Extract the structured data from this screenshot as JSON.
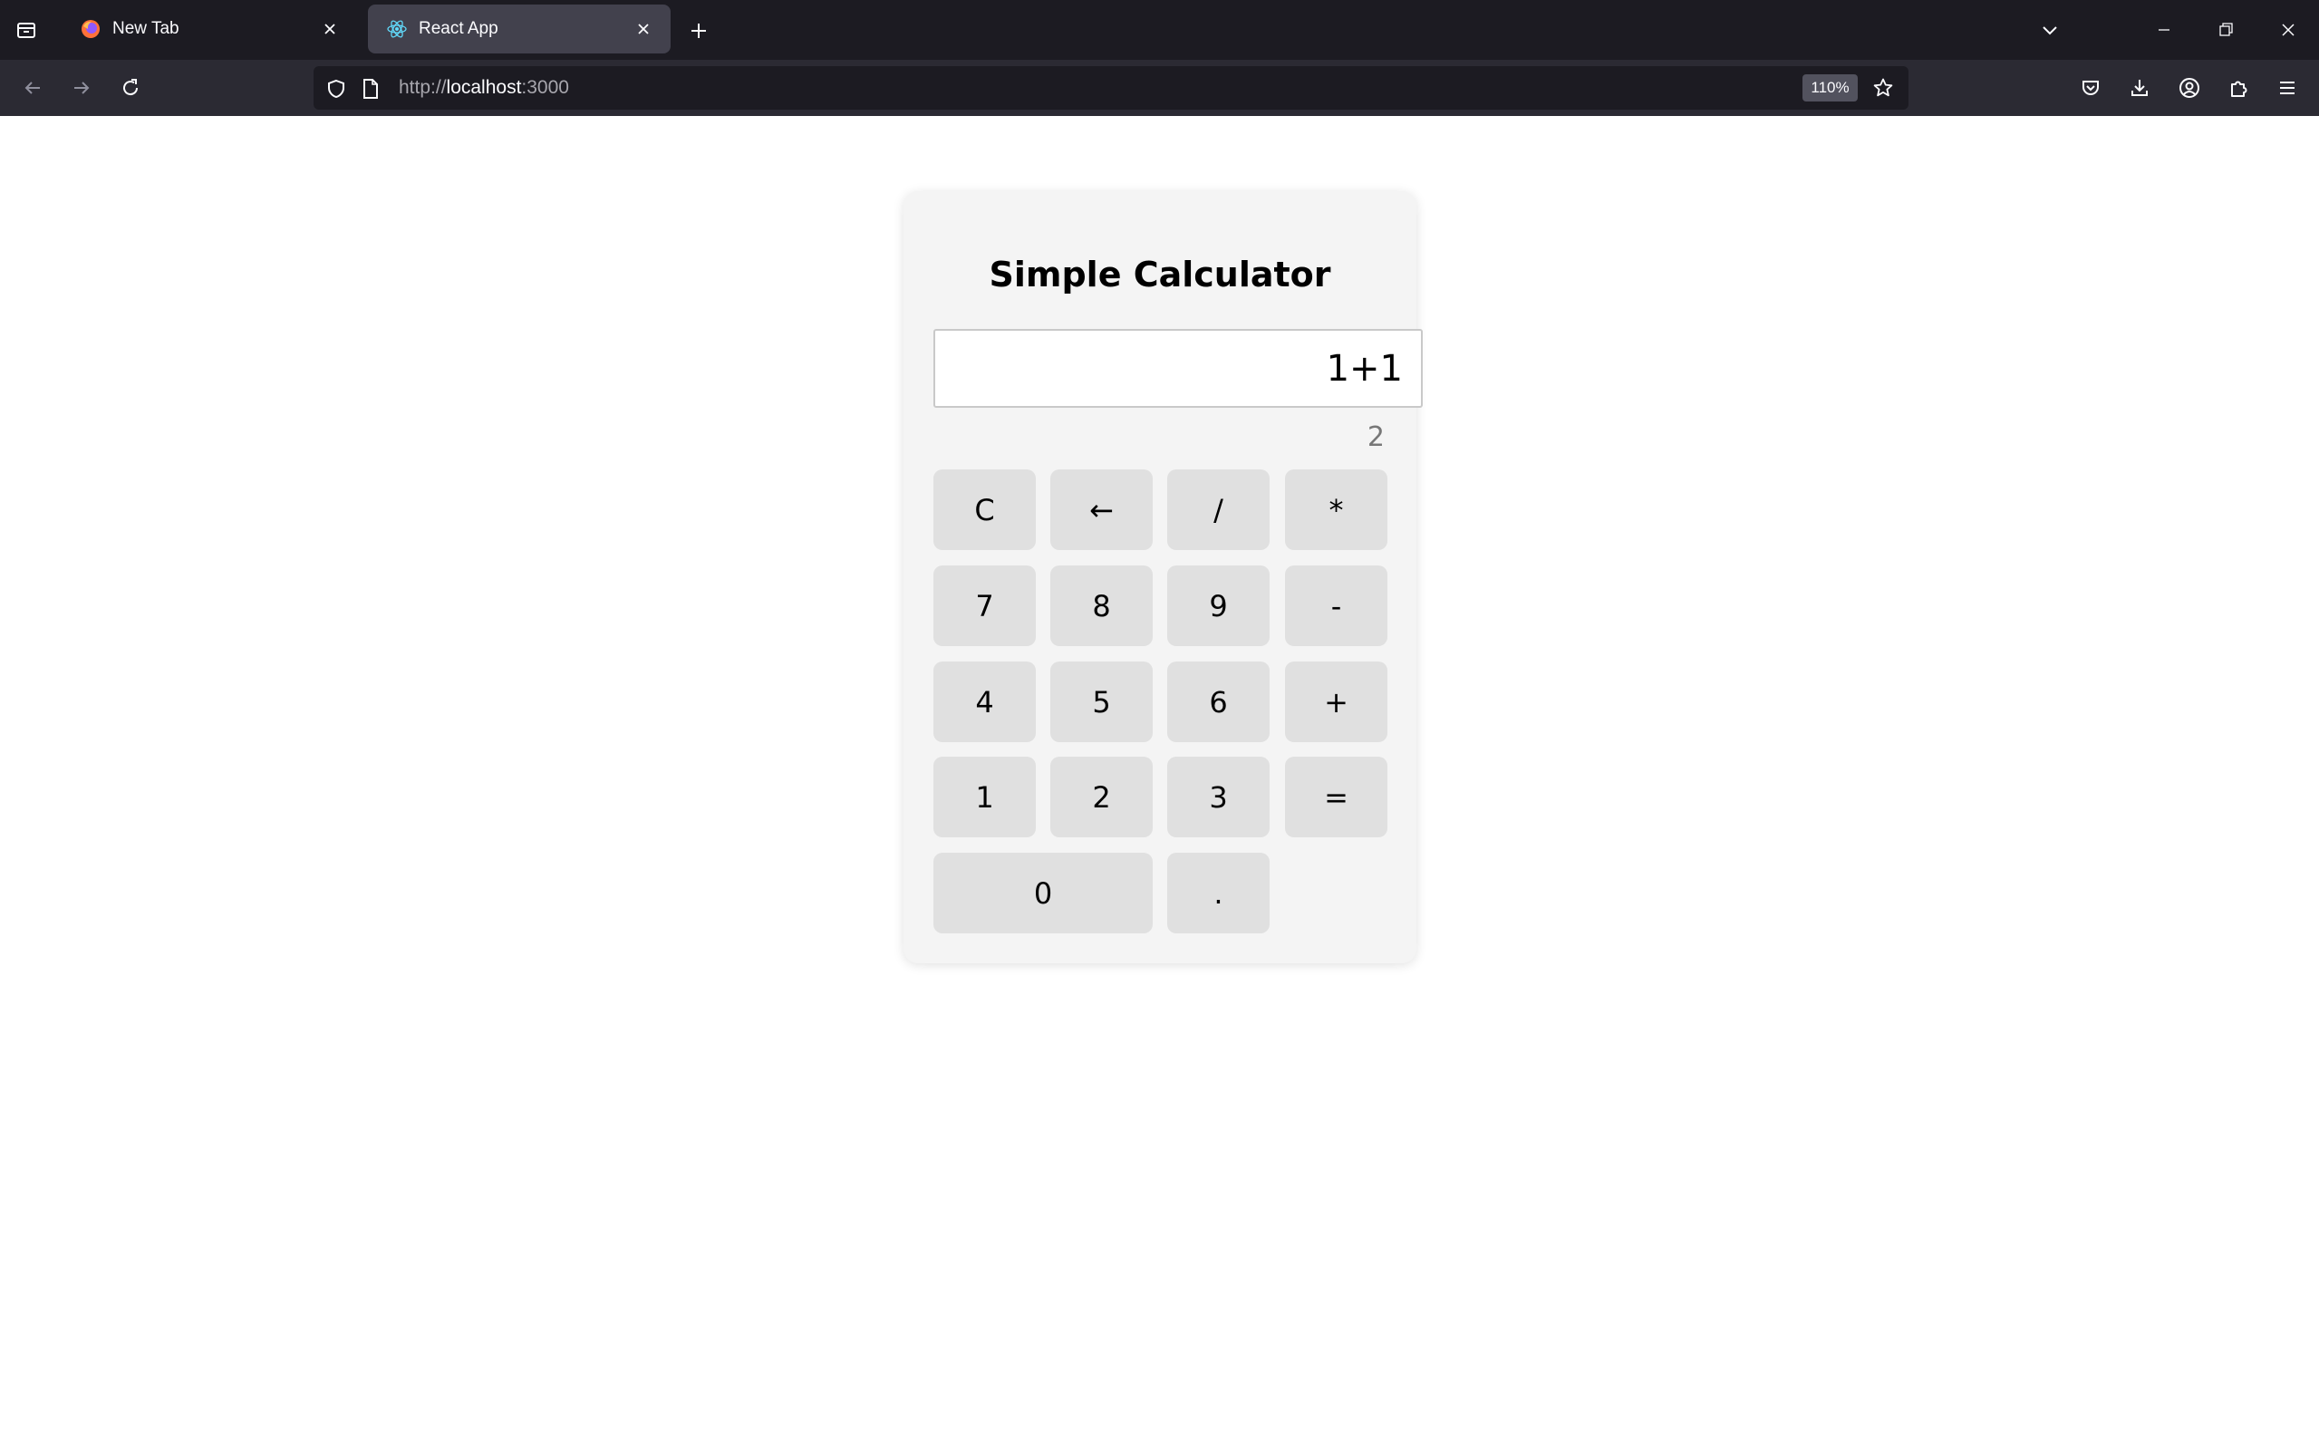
{
  "browser": {
    "tabs": [
      {
        "label": "New Tab",
        "icon": "firefox-icon",
        "active": false
      },
      {
        "label": "React App",
        "icon": "react-icon",
        "active": true
      }
    ],
    "address": {
      "scheme": "http://",
      "host": "localhost",
      "port": ":3000"
    },
    "zoom": "110%",
    "colors": {
      "tabbar": "#1c1b22",
      "navbar": "#2b2a33",
      "active_tab": "#42414d"
    }
  },
  "calculator": {
    "title": "Simple Calculator",
    "display_value": "1+1",
    "result": "2",
    "keys": {
      "clear": "C",
      "backspace": "←",
      "divide": "/",
      "multiply": "*",
      "seven": "7",
      "eight": "8",
      "nine": "9",
      "minus": "-",
      "four": "4",
      "five": "5",
      "six": "6",
      "plus": "+",
      "one": "1",
      "two": "2",
      "three": "3",
      "equals": "=",
      "zero": "0",
      "decimal": "."
    },
    "colors": {
      "card": "#f4f4f4",
      "key": "#e0e0e0",
      "result_text": "#777777"
    }
  }
}
